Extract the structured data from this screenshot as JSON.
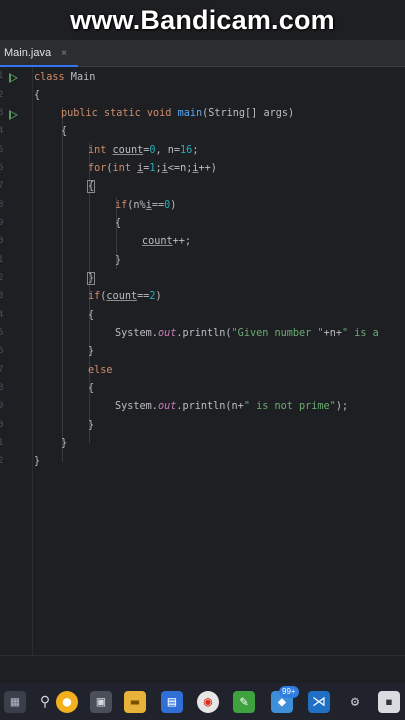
{
  "watermark": "www.Bandicam.com",
  "tab": {
    "filename": "Main.java",
    "close_glyph": "×"
  },
  "gutter_numbers": [
    "1",
    "2",
    "3",
    "4",
    "5",
    "6",
    "7",
    "8",
    "9",
    "0",
    "1",
    "2",
    "3",
    "4",
    "5",
    "6",
    "7",
    "8",
    "9",
    "0",
    "1",
    "2"
  ],
  "code": {
    "l1_kw": "class",
    "l1_name": " Main",
    "l2": "{",
    "l3_kw1": "public",
    "l3_kw2": " static",
    "l3_kw3": " void ",
    "l3_fn": "main",
    "l3_rest": "(String[] args)",
    "l4": "{",
    "l5_kw": "int ",
    "l5_var": "count",
    "l5_eq": "=",
    "l5_num1": "0",
    "l5_mid": ", n=",
    "l5_num2": "16",
    "l5_end": ";",
    "l6_kw": "for",
    "l6_a": "(",
    "l6_kw2": "int ",
    "l6_var1": "i",
    "l6_b": "=",
    "l6_num": "1",
    "l6_c": ";",
    "l6_var2": "i",
    "l6_d": "<=n;",
    "l6_var3": "i",
    "l6_e": "++)",
    "l7": "{",
    "l8_kw": "if",
    "l8_a": "(n%",
    "l8_var": "i",
    "l8_b": "==",
    "l8_num": "0",
    "l8_c": ")",
    "l9": "{",
    "l10_var": "count",
    "l10_rest": "++;",
    "l11": "}",
    "l12": "}",
    "l13_kw": "if",
    "l13_a": "(",
    "l13_var": "count",
    "l13_b": "==",
    "l13_num": "2",
    "l13_c": ")",
    "l14": "{",
    "l15_a": "System.",
    "l15_fld": "out",
    "l15_b": ".println(",
    "l15_str1": "\"Given number \"",
    "l15_c": "+n+",
    "l15_str2": "\" is a",
    "l16": "}",
    "l17_kw": "else",
    "l18": "{",
    "l19_a": "System.",
    "l19_fld": "out",
    "l19_b": ".println(n+",
    "l19_str": "\" is not prime\"",
    "l19_c": ");",
    "l20": "}",
    "l21": "}",
    "l22": "}"
  },
  "taskbar": {
    "icons": [
      "windows-icon",
      "search-icon",
      "taskview-icon",
      "explorer-icon",
      "store-icon",
      "chrome-icon",
      "files-icon",
      "whatsapp-icon",
      "vscode-icon",
      "settings-icon",
      "other-icon"
    ],
    "badge": "99+"
  },
  "colors": {
    "keyword": "#cf8e6d",
    "function": "#56a8f5",
    "number": "#2aacb8",
    "string": "#6aab73",
    "field": "#c77dbb",
    "accent": "#3574f0"
  }
}
